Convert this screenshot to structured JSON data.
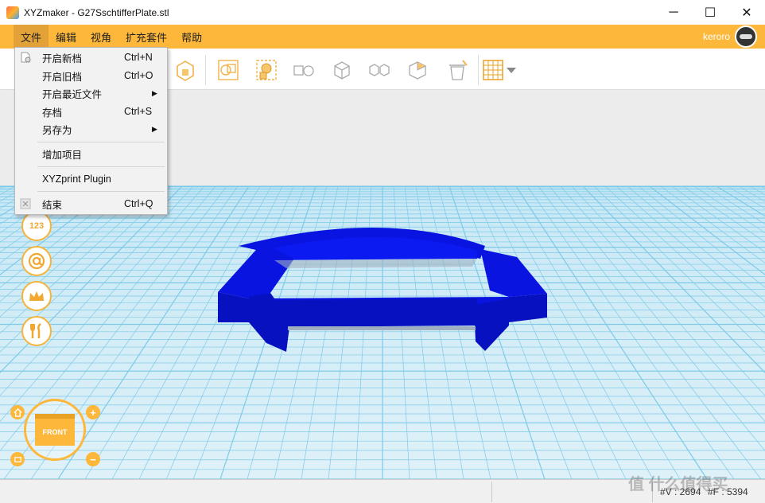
{
  "window": {
    "title": "XYZmaker - G27SschtifferPlate.stl",
    "minimize": "─",
    "maximize": "☐",
    "close": "✕"
  },
  "menubar": {
    "items": [
      "文件",
      "编辑",
      "视角",
      "扩充套件",
      "帮助"
    ],
    "active_index": 0,
    "user_name": "keroro"
  },
  "file_menu": {
    "items": [
      {
        "label": "开启新档",
        "shortcut": "Ctrl+N",
        "icon": "new-file-icon"
      },
      {
        "label": "开启旧档",
        "shortcut": "Ctrl+O"
      },
      {
        "label": "开启最近文件",
        "submenu": true
      },
      {
        "label": "存档",
        "shortcut": "Ctrl+S"
      },
      {
        "label": "另存为",
        "submenu": true
      },
      {
        "label": "增加项目"
      },
      {
        "label": "XYZprint Plugin"
      },
      {
        "label": "结束",
        "shortcut": "Ctrl+Q",
        "icon": "exit-icon"
      }
    ],
    "submenu_arrow": "▶"
  },
  "toolbar": {
    "icons": [
      "shape-icon",
      "group-icon",
      "align-icon",
      "primitives-icon",
      "solid-icon",
      "mirror-icon",
      "hollow-icon",
      "trash-icon",
      "grid-icon"
    ]
  },
  "left_tools": {
    "number_label": "123",
    "icons": [
      "number-icon",
      "at-icon",
      "crown-icon",
      "tools-icon"
    ]
  },
  "view_cube": {
    "face_label": "FRONT",
    "zoom_in": "+",
    "zoom_out": "−"
  },
  "status": {
    "vertices": "#V : 2694",
    "faces": "#F : 5394"
  },
  "watermark": "值 什么值得买",
  "colors": {
    "accent": "#fdb73a",
    "model": "#0a14e0",
    "grid": "#8fd3ee"
  }
}
